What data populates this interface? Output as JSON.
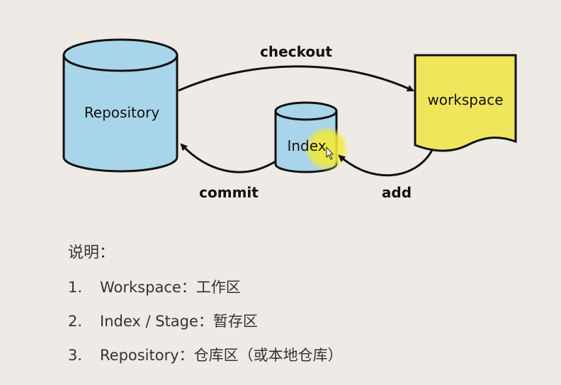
{
  "diagram": {
    "repository_label": "Repository",
    "index_label": "Index",
    "workspace_label": "workspace",
    "checkout_label": "checkout",
    "commit_label": "commit",
    "add_label": "add",
    "colors": {
      "cylinder_fill": "#a9d5ea",
      "workspace_fill": "#f0e65c",
      "cursor_highlight": "#f2ea3a",
      "background": "#eeebe6"
    }
  },
  "notes": {
    "title": "说明：",
    "items": [
      {
        "num": "1.",
        "text": "Workspace：工作区"
      },
      {
        "num": "2.",
        "text": "Index / Stage：暂存区"
      },
      {
        "num": "3.",
        "text": "Repository：仓库区（或本地仓库）"
      }
    ]
  }
}
